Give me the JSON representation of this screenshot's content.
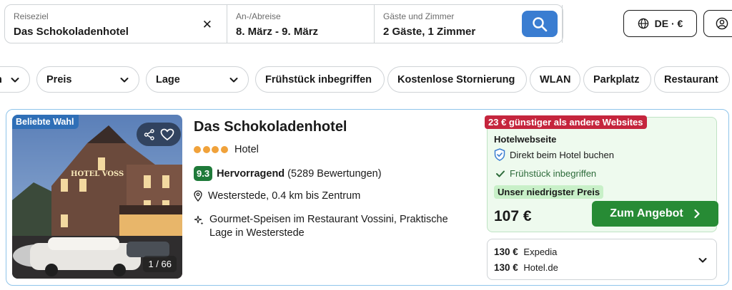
{
  "search": {
    "destination_label": "Reiseziel",
    "destination_value": "Das Schokoladenhotel",
    "clear_icon": "close-icon",
    "dates_label": "An-/Abreise",
    "dates_value": "8. März - 9. März",
    "guests_label": "Gäste und Zimmer",
    "guests_value": "2 Gäste, 1 Zimmer",
    "search_icon": "search-icon"
  },
  "header": {
    "locale_label": "DE · €",
    "locale_icon": "globe-icon",
    "user_icon": "user-icon"
  },
  "filters": {
    "chips": [
      {
        "label": "n",
        "has_dropdown": true
      },
      {
        "label": "Preis",
        "has_dropdown": true
      },
      {
        "label": "Lage",
        "has_dropdown": true
      },
      {
        "label": "Frühstück inbegriffen",
        "has_dropdown": false
      },
      {
        "label": "Kostenlose Stornierung",
        "has_dropdown": false
      },
      {
        "label": "WLAN",
        "has_dropdown": false
      },
      {
        "label": "Parkplatz",
        "has_dropdown": false
      },
      {
        "label": "Restaurant",
        "has_dropdown": false
      }
    ]
  },
  "result": {
    "badge": "Beliebte Wahl",
    "photo_counter": "1 / 66",
    "photo_sign_text": "HOTEL VOSS",
    "name": "Das Schokoladenhotel",
    "stars": 4,
    "type": "Hotel",
    "score": "9.3",
    "score_label": "Hervorragend",
    "reviews": "(5289 Bewertungen)",
    "location": "Westerstede, 0.4 km bis Zentrum",
    "features": "Gourmet-Speisen im Restaurant Vossini, Praktische Lage in Westerstede",
    "deal": {
      "tag": "23 € günstiger als andere Websites",
      "provider": "Hotelwebseite",
      "row1": "Direkt beim Hotel buchen",
      "row2": "Frühstück inbegriffen",
      "lowest": "Unser niedrigster Preis",
      "price": "107 €",
      "cta": "Zum Angebot"
    },
    "other_offers": [
      {
        "price": "130 €",
        "site": "Expedia"
      },
      {
        "price": "130 €",
        "site": "Hotel.de"
      }
    ]
  },
  "colors": {
    "search_button": "#3a7dd1",
    "deal_tag": "#c5253d",
    "cta": "#278b35",
    "score": "#1f7a3a",
    "card_border": "#8fc4ea"
  }
}
